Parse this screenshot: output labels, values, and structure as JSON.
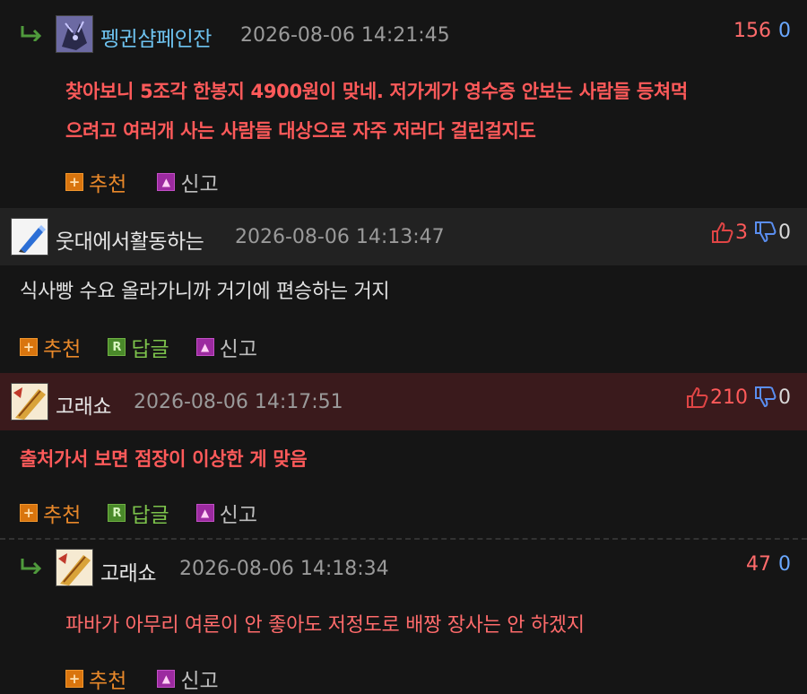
{
  "comments": [
    {
      "nickname": "펭귄샴페인잔",
      "date": "2026-08-06 14:21:45",
      "count_up": "156",
      "count_down": "0",
      "lines": [
        "찾아보니 5조각 한봉지 4900원이 맞네. 저가게가 영수증 안보는 사람들 등쳐먹",
        "으려고 여러개 사는 사람들 대상으로 자주 저러다 걸린걸지도"
      ],
      "actions": {
        "recommend": "추천",
        "report": "신고"
      }
    },
    {
      "nickname": "웃대에서활동하는",
      "date": "2026-08-06 14:13:47",
      "count_up": "3",
      "count_down": "0",
      "lines": [
        "식사빵 수요 올라가니까 거기에 편승하는 거지"
      ],
      "actions": {
        "recommend": "추천",
        "reply": "답글",
        "report": "신고"
      }
    },
    {
      "nickname": "고래쇼",
      "date": "2026-08-06 14:17:51",
      "count_up": "210",
      "count_down": "0",
      "lines": [
        "출처가서 보면 점장이 이상한 게 맞음"
      ],
      "actions": {
        "recommend": "추천",
        "reply": "답글",
        "report": "신고"
      }
    },
    {
      "nickname": "고래쇼",
      "date": "2026-08-06 14:18:34",
      "count_up": "47",
      "count_down": "0",
      "lines": [
        "파바가 아무리 여론이 안 좋아도 저정도로 배짱 장사는 안 하겠지"
      ],
      "actions": {
        "recommend": "추천",
        "report": "신고"
      }
    }
  ],
  "colors": {
    "background": "#151515",
    "header_normal": "#222222",
    "header_best": "#3a1a1c",
    "best_text": "#ff5a5a",
    "reply_text": "#ff6b6b",
    "nickname_link": "#6ec3f0",
    "recommend": "#e8882a",
    "reply_green": "#7cc24b"
  }
}
